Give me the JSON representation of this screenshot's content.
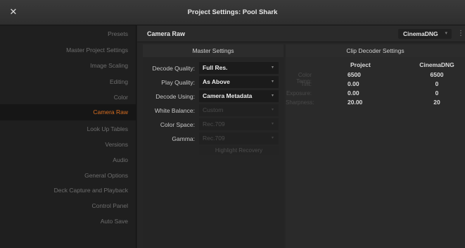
{
  "window": {
    "title": "Project Settings:  Pool Shark",
    "close_glyph": "✕"
  },
  "sidebar": {
    "items": [
      {
        "label": "Presets"
      },
      {
        "label": "Master Project Settings"
      },
      {
        "label": "Image Scaling"
      },
      {
        "label": "Editing"
      },
      {
        "label": "Color"
      },
      {
        "label": "Camera Raw",
        "active": true
      },
      {
        "label": "Look Up Tables"
      },
      {
        "label": "Versions"
      },
      {
        "label": "Audio"
      },
      {
        "label": "General Options"
      },
      {
        "label": "Deck Capture and Playback"
      },
      {
        "label": "Control Panel"
      },
      {
        "label": "Auto Save"
      }
    ]
  },
  "header": {
    "section_title": "Camera Raw",
    "format_value": "CinemaDNG",
    "format_arrow": "▾",
    "more_glyph": "⋮"
  },
  "master": {
    "title": "Master Settings",
    "rows": [
      {
        "label": "Decode Quality:",
        "value": "Full Res.",
        "enabled": true
      },
      {
        "label": "Play Quality:",
        "value": "As Above",
        "enabled": true
      },
      {
        "label": "Decode Using:",
        "value": "Camera Metadata",
        "enabled": true
      },
      {
        "label": "White Balance:",
        "value": "Custom",
        "enabled": false
      },
      {
        "label": "Color Space:",
        "value": "Rec.709",
        "enabled": false
      },
      {
        "label": "Gamma:",
        "value": "Rec.709",
        "enabled": false
      }
    ],
    "arrow": "▾",
    "highlight_recovery": "Highlight Recovery"
  },
  "decoder": {
    "title": "Clip Decoder Settings",
    "col_project": "Project",
    "col_clip": "CinemaDNG",
    "rows": [
      {
        "label": "Color Temp:",
        "project": "6500",
        "clip": "6500"
      },
      {
        "label": "Tint:",
        "project": "0.00",
        "clip": "0"
      },
      {
        "label": "Exposure:",
        "project": "0.00",
        "clip": "0"
      },
      {
        "label": "Sharpness:",
        "project": "20.00",
        "clip": "20"
      }
    ]
  },
  "colors": {
    "accent": "#d96e20",
    "bg": "#1e1e1e",
    "panel": "#262626"
  }
}
